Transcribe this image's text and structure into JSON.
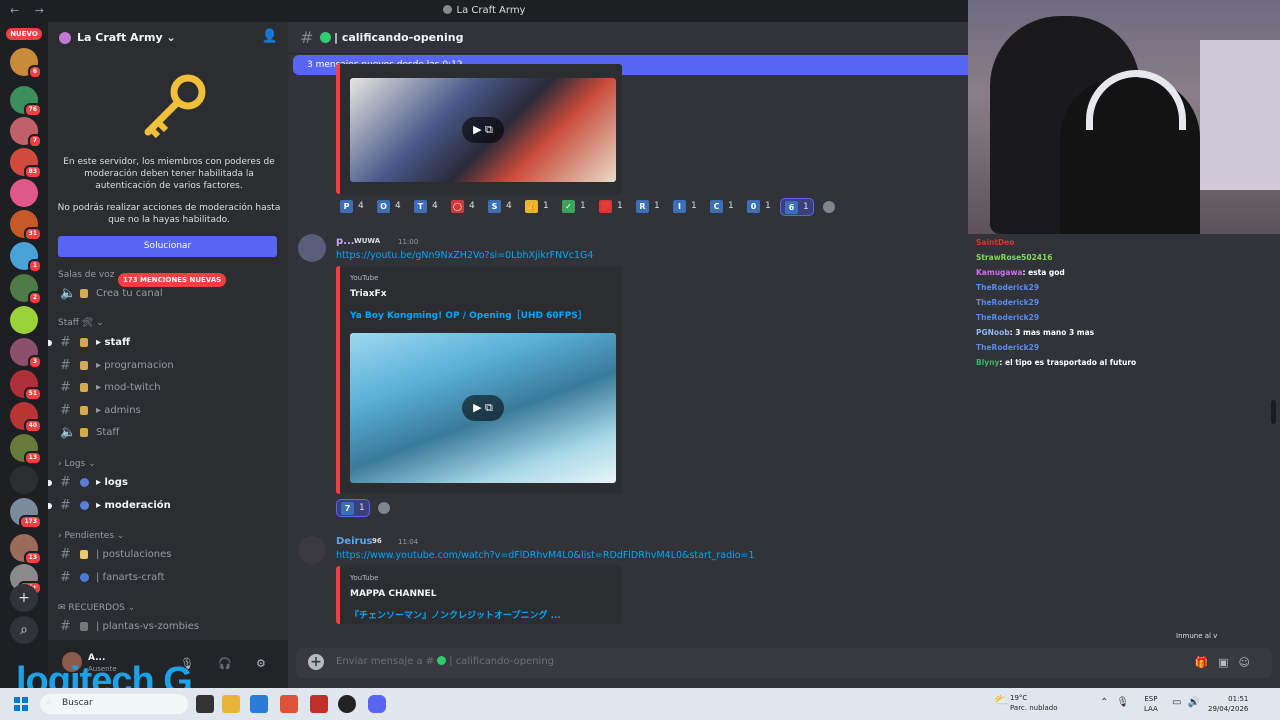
{
  "window": {
    "title": "La Craft Army",
    "nav": "← →"
  },
  "rail": {
    "nuevo": "NUEVO",
    "servers": [
      {
        "badge": "6",
        "color": "#c98a3b"
      },
      {
        "badge": "76",
        "color": "#3a8f5a"
      },
      {
        "badge": "7",
        "color": "#c0616a"
      },
      {
        "badge": "83",
        "color": "#d24a3c"
      },
      {
        "badge": "",
        "color": "#e0588a"
      },
      {
        "badge": "31",
        "color": "#c55a28"
      },
      {
        "badge": "1",
        "color": "#4aa3d8"
      },
      {
        "badge": "2",
        "color": "#4d7a46"
      },
      {
        "badge": "",
        "color": "#9bd23a"
      },
      {
        "badge": "3",
        "color": "#8b4f6a"
      },
      {
        "badge": "51",
        "color": "#b0303a"
      },
      {
        "badge": "40",
        "color": "#b83535"
      },
      {
        "badge": "13",
        "color": "#6a7a3a"
      },
      {
        "badge": "",
        "color": "#2b2d31"
      },
      {
        "badge": "173",
        "color": "#7a8a9a"
      },
      {
        "badge": "13",
        "color": "#9a6a5a"
      },
      {
        "badge": "1K+",
        "color": "#8a8a8a"
      }
    ],
    "add_icon": "+",
    "explore_icon": "⌕"
  },
  "sidebar": {
    "server_name": "La Craft Army ⌄",
    "notice_1": "En este servidor, los miembros con poderes de moderación deben tener habilitada la autenticación de varios factores.",
    "notice_2": "No podrás realizar acciones de moderación hasta que no la hayas habilitado.",
    "button": "Solucionar",
    "voice_category": "Salas de voz",
    "mentions_pill": "173 MENCIONES NUEVAS",
    "create_channel": "Crea tu canal",
    "cat_staff": "Staff 🛠 ⌄",
    "ch_staff": "▸ staff",
    "ch_programacion": "▸ programacion",
    "ch_mod_twitch": "▸ mod-twitch",
    "ch_admins": "▸ admins",
    "ch_staff_voice": "Staff",
    "cat_logs": "› Logs ⌄",
    "ch_logs": "▸ logs",
    "ch_moderacion": "▸ moderación",
    "cat_pendientes": "› Pendientes ⌄",
    "ch_postulaciones": "| postulaciones",
    "ch_fanarts": "| fanarts-craft",
    "cat_recuerdos": "✉ RECUERDOS ⌄",
    "ch_plantas": "| plantas-vs-zombies",
    "user_name": "A...",
    "user_status": "Ausente",
    "logitech": "logitech G"
  },
  "chat": {
    "channel_name": "| calificando-opening",
    "new_messages": "3 mensajes nuevos desde las 0:12",
    "reactions_1": [
      {
        "em": "P",
        "count": "4",
        "color": "#3d6fb8"
      },
      {
        "em": "O",
        "count": "4",
        "color": "#3d6fb8"
      },
      {
        "em": "T",
        "count": "4",
        "color": "#3d6fb8"
      },
      {
        "em": "◯",
        "count": "4",
        "color": "#d23a3a"
      },
      {
        "em": "S",
        "count": "4",
        "color": "#3d6fb8"
      },
      {
        "em": "👍",
        "count": "1",
        "color": "#e8b53a"
      },
      {
        "em": "✓",
        "count": "1",
        "color": "#3aa55a"
      },
      {
        "em": "💯",
        "count": "1",
        "color": "#d23a3a"
      },
      {
        "em": "R",
        "count": "1",
        "color": "#3d6fb8"
      },
      {
        "em": "I",
        "count": "1",
        "color": "#3d6fb8"
      },
      {
        "em": "C",
        "count": "1",
        "color": "#3d6fb8"
      },
      {
        "em": "0",
        "count": "1",
        "color": "#3d6fb8"
      },
      {
        "em": "6",
        "count": "1",
        "color": "#3d6fb8",
        "me": true
      }
    ],
    "msg2": {
      "author": "p...",
      "tag": "WUWA",
      "time": "11:00",
      "link": "https://youtu.be/gNn9NxZH2Vo?si=0LbhXjikrFNVc1G4",
      "provider": "YouTube",
      "channel": "TriaxFx",
      "title": "Ya Boy Kongming! OP / Opening［UHD 60FPS］",
      "reaction": {
        "em": "7",
        "count": "1"
      }
    },
    "msg3": {
      "author": "Deirus",
      "tag": "96",
      "time": "11:04",
      "link": "https://www.youtube.com/watch?v=dFlDRhvM4L0&list=RDdFlDRhvM4L0&start_radio=1",
      "provider": "YouTube",
      "channel": "MAPPA CHANNEL",
      "title": "『チェンソーマン』ノンクレジットオープニング ..."
    },
    "composer_placeholder": "Enviar mensaje a #",
    "composer_channel": "| calificando-opening"
  },
  "twitch_chat": [
    {
      "user": "SaintDeo",
      "msg": "",
      "color": "#e0312a"
    },
    {
      "user": "StrawRose502416",
      "msg": "",
      "color": "#7ed957"
    },
    {
      "user": "Kamugawa",
      "msg": ": esta god",
      "color": "#d06cf0"
    },
    {
      "user": "TheRoderick29",
      "msg": "",
      "color": "#5a8aee"
    },
    {
      "user": "TheRoderick29",
      "msg": "",
      "color": "#5a8aee"
    },
    {
      "user": "TheRoderick29",
      "msg": "",
      "color": "#5a8aee"
    },
    {
      "user": "PGNoob",
      "msg": ": 3 mas mano 3 mas",
      "color": "#8fb8f0"
    },
    {
      "user": "TheRoderick29",
      "msg": "",
      "color": "#5a8aee"
    },
    {
      "user": "Blyny",
      "msg": ": el tipo es trasportado al futuro",
      "color": "#3fae6a"
    }
  ],
  "overlay_inmune": "Inmune al v",
  "taskbar": {
    "search": "Buscar",
    "temp": "19°C",
    "weather": "Parc. nublado",
    "lang_1": "ESP",
    "lang_2": "LAA",
    "time": "01:51",
    "date": "29/04/2026"
  }
}
